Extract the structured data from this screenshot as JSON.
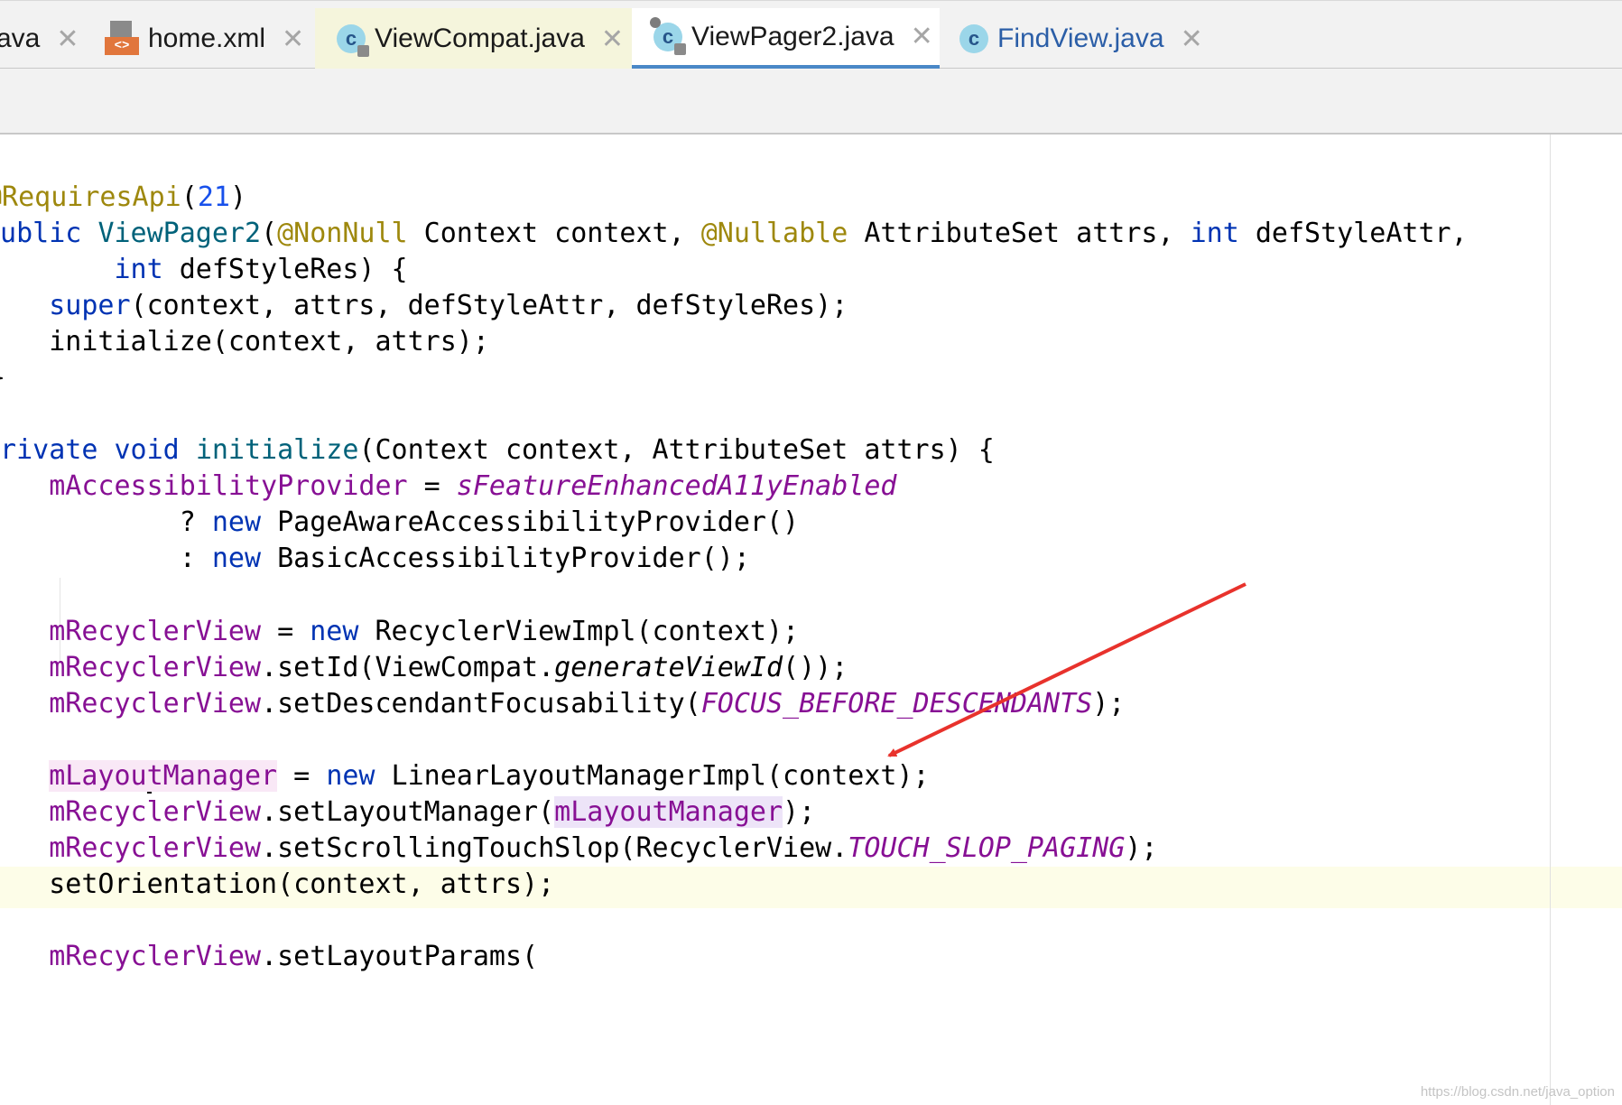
{
  "tabs": [
    {
      "label": "ava",
      "icon": "none"
    },
    {
      "label": "home.xml",
      "icon": "xml-file-icon"
    },
    {
      "label": "ViewCompat.java",
      "icon": "java-class-icon"
    },
    {
      "label": "ViewPager2.java",
      "icon": "java-class-icon",
      "active": true
    },
    {
      "label": "FindView.java",
      "icon": "java-class-icon"
    }
  ],
  "code": {
    "l0": "}",
    "l1": [
      {
        "t": "@RequiresApi",
        "c": "ann"
      },
      {
        "t": "("
      },
      {
        "t": "21",
        "c": "num"
      },
      {
        "t": ")"
      }
    ],
    "l2": [
      {
        "t": "public",
        "c": "kw"
      },
      {
        "t": " "
      },
      {
        "t": "ViewPager2",
        "c": "mdecl"
      },
      {
        "t": "("
      },
      {
        "t": "@NonNull",
        "c": "ann"
      },
      {
        "t": " Context context, "
      },
      {
        "t": "@Nullable",
        "c": "ann"
      },
      {
        "t": " AttributeSet attrs, "
      },
      {
        "t": "int",
        "c": "kw"
      },
      {
        "t": " defStyleAttr,"
      }
    ],
    "l3": [
      {
        "t": "        "
      },
      {
        "t": "int",
        "c": "kw"
      },
      {
        "t": " defStyleRes) {"
      }
    ],
    "l4": [
      {
        "t": "    "
      },
      {
        "t": "super",
        "c": "kw"
      },
      {
        "t": "(context, attrs, defStyleAttr, defStyleRes);"
      }
    ],
    "l5": [
      {
        "t": "    initialize(context, attrs);"
      }
    ],
    "l6": "}",
    "l7": [
      {
        "t": "private",
        "c": "kw"
      },
      {
        "t": " "
      },
      {
        "t": "void",
        "c": "kw"
      },
      {
        "t": " "
      },
      {
        "t": "initialize",
        "c": "mdecl"
      },
      {
        "t": "(Context context, AttributeSet attrs) {"
      }
    ],
    "l8": [
      {
        "t": "    "
      },
      {
        "t": "mAccessibilityProvider",
        "c": "fld"
      },
      {
        "t": " = "
      },
      {
        "t": "sFeatureEnhancedA11yEnabled",
        "c": "sfld"
      }
    ],
    "l9": [
      {
        "t": "            ? "
      },
      {
        "t": "new",
        "c": "kw"
      },
      {
        "t": " PageAwareAccessibilityProvider()"
      }
    ],
    "l10": [
      {
        "t": "            : "
      },
      {
        "t": "new",
        "c": "kw"
      },
      {
        "t": " BasicAccessibilityProvider();"
      }
    ],
    "l11": [
      {
        "t": "    "
      },
      {
        "t": "mRecyclerView",
        "c": "fld"
      },
      {
        "t": " = "
      },
      {
        "t": "new",
        "c": "kw"
      },
      {
        "t": " RecyclerViewImpl(context);"
      }
    ],
    "l12": [
      {
        "t": "    "
      },
      {
        "t": "mRecyclerView",
        "c": "fld"
      },
      {
        "t": ".setId(ViewCompat."
      },
      {
        "t": "generateViewId",
        "c": "smeth"
      },
      {
        "t": "());"
      }
    ],
    "l13": [
      {
        "t": "    "
      },
      {
        "t": "mRecyclerView",
        "c": "fld"
      },
      {
        "t": ".setDescendantFocusability("
      },
      {
        "t": "FOCUS_BEFORE_DESCENDANTS",
        "c": "sfld"
      },
      {
        "t": ");"
      }
    ],
    "l14": [
      {
        "t": "    "
      },
      {
        "t": "mLayou",
        "c": "fld hl-pink"
      },
      {
        "caret": true
      },
      {
        "t": "tManager",
        "c": "fld hl-pink"
      },
      {
        "t": " = "
      },
      {
        "t": "new",
        "c": "kw"
      },
      {
        "t": " LinearLayoutManagerImpl(context);"
      }
    ],
    "l15": [
      {
        "t": "    "
      },
      {
        "t": "mRecyclerView",
        "c": "fld"
      },
      {
        "t": ".setLayoutManager("
      },
      {
        "t": "mLayoutManager",
        "c": "fld hl-lav"
      },
      {
        "t": ");"
      }
    ],
    "l16": [
      {
        "t": "    "
      },
      {
        "t": "mRecyclerView",
        "c": "fld"
      },
      {
        "t": ".setScrollingTouchSlop(RecyclerView."
      },
      {
        "t": "TOUCH_SLOP_PAGING",
        "c": "sfld"
      },
      {
        "t": ");"
      }
    ],
    "l17": [
      {
        "t": "    setOrientation(context, attrs);"
      }
    ],
    "l18": [
      {
        "t": "    "
      },
      {
        "t": "mRecyclerView",
        "c": "fld"
      },
      {
        "t": ".setLayoutParams("
      }
    ]
  },
  "annotation": {
    "color": "#e8322c"
  },
  "watermark": "https://blog.csdn.net/java_option",
  "colors": {
    "keyword": "#0033b3",
    "annotation": "#9e880d",
    "field": "#871094",
    "number": "#1750eb",
    "method_decl": "#00627a",
    "active_tab_underline": "#4a88c7"
  }
}
